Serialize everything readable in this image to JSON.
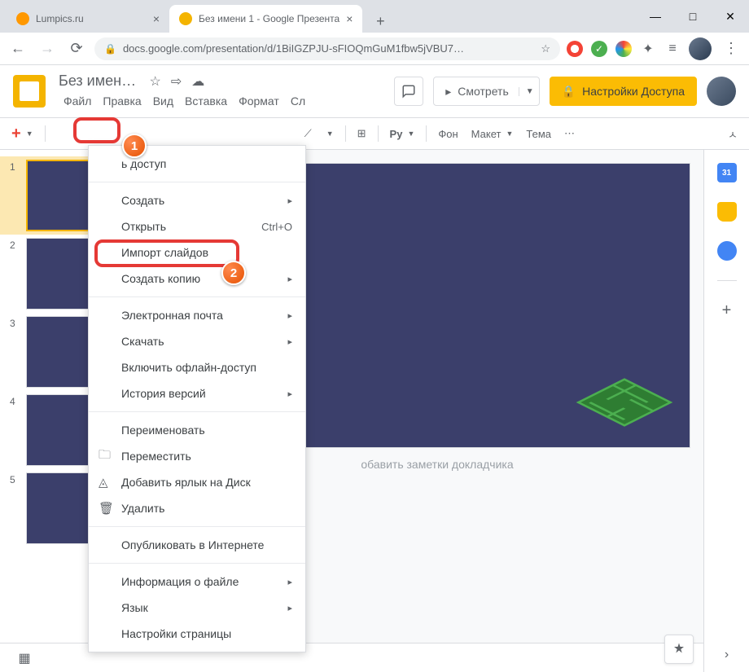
{
  "browser": {
    "tabs": [
      {
        "title": "Lumpics.ru",
        "favicon": "#ff9800"
      },
      {
        "title": "Без имени 1 - Google Презента",
        "favicon": "#f4b400"
      }
    ],
    "url": "docs.google.com/presentation/d/1BiIGZPJU-sFIOQmGuM1fbw5jVBU7…"
  },
  "doc": {
    "title": "Без имен…",
    "menus": [
      "Файл",
      "Правка",
      "Вид",
      "Вставка",
      "Формат",
      "Сл"
    ],
    "present": "Смотреть",
    "share": "Настройки Доступа"
  },
  "toolbar": {
    "newslide": "+",
    "textbox": "Py",
    "bg": "Фон",
    "layout": "Макет",
    "theme": "Тема"
  },
  "thumbs": [
    "1",
    "2",
    "3",
    "4",
    "5"
  ],
  "notes_placeholder": "обавить заметки докладчика",
  "menu": {
    "share": "ь доступ",
    "create": "Создать",
    "open": "Открыть",
    "open_sc": "Ctrl+O",
    "import": "Импорт слайдов",
    "copy": "Создать копию",
    "email": "Электронная почта",
    "download": "Скачать",
    "offline": "Включить офлайн-доступ",
    "versions": "История версий",
    "rename": "Переименовать",
    "move": "Переместить",
    "adddrive": "Добавить ярлык на Диск",
    "delete": "Удалить",
    "publish": "Опубликовать в Интернете",
    "info": "Информация о файле",
    "lang": "Язык",
    "pagesetup": "Настройки страницы"
  },
  "badges": {
    "one": "1",
    "two": "2"
  }
}
